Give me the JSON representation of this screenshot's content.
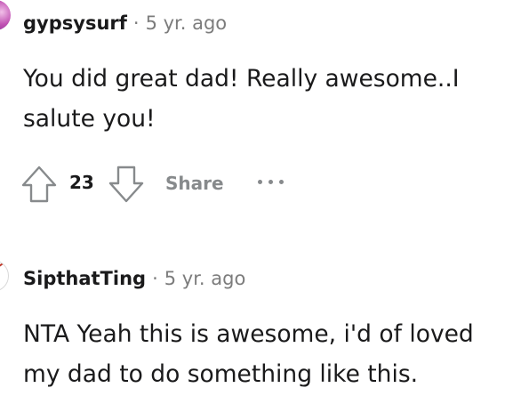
{
  "comments": [
    {
      "username": "gypsysurf",
      "separator": "·",
      "time": "5 yr. ago",
      "lines": [
        "You did great dad! Really awesome..I",
        "salute you!"
      ],
      "score": "23",
      "share_label": "Share",
      "upvote_icon": "arrow-up-icon",
      "downvote_icon": "arrow-down-icon",
      "more_icon": "ellipsis-icon"
    },
    {
      "username": "SipthatTing",
      "separator": "·",
      "time": "5 yr. ago",
      "lines": [
        "NTA Yeah this is awesome, i'd of loved",
        "my dad to do something like this."
      ]
    }
  ]
}
